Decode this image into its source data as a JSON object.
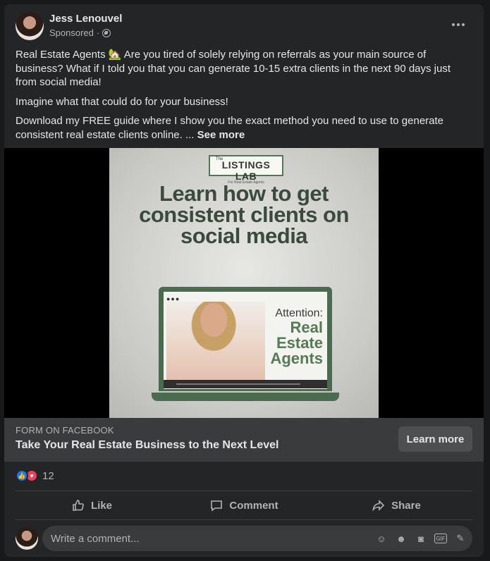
{
  "post": {
    "author": "Jess Lenouvel",
    "sponsored": "Sponsored",
    "sep": "·",
    "paragraphs": [
      "Real Estate Agents 🏡  Are you tired of solely relying on referrals as your main source of business? What if I told you that you can generate 10-15 extra clients in the next 90 days just from social media!",
      "Imagine what that could do for your business!",
      "Download my FREE guide where I show you the exact method you need to use to generate consistent real estate clients online. ..."
    ],
    "see_more": "See more"
  },
  "ad_image": {
    "logo": "LISTINGS LAB",
    "logo_sub": "For Real Estate Agents",
    "logo_the": "The",
    "headline": "Learn how to get consistent clients on social media",
    "attention": "Attention:",
    "target_lines": [
      "Real",
      "Estate",
      "Agents"
    ]
  },
  "cta": {
    "source": "FORM ON FACEBOOK",
    "title": "Take Your Real Estate Business to the Next Level",
    "button": "Learn more"
  },
  "reactions": {
    "count": "12",
    "types": [
      "like",
      "love"
    ]
  },
  "actions": {
    "like": "Like",
    "comment": "Comment",
    "share": "Share"
  },
  "comment_box": {
    "placeholder": "Write a comment...",
    "icons": [
      "avatar-sticker-icon",
      "emoji-icon",
      "camera-icon",
      "gif-icon",
      "sticker-icon"
    ]
  },
  "colors": {
    "background": "#242526",
    "cta_bar": "#3a3b3c",
    "like_blue": "#1877f2",
    "love_red": "#f33e58",
    "ad_green": "#4a6b4d"
  }
}
